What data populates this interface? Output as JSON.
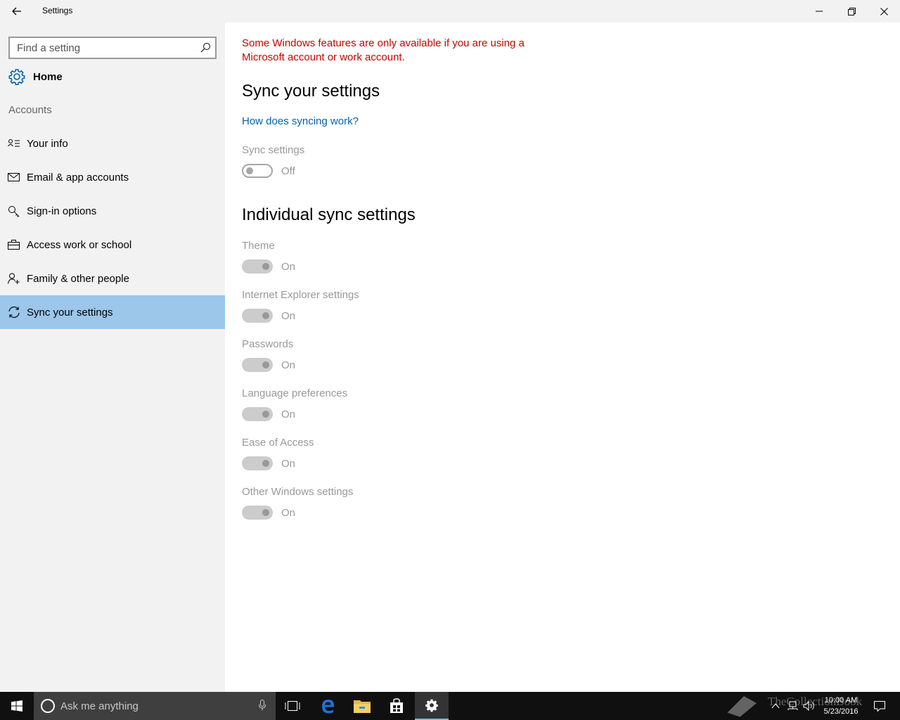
{
  "window": {
    "title": "Settings"
  },
  "sidebar": {
    "search_placeholder": "Find a setting",
    "home_label": "Home",
    "section_title": "Accounts",
    "items": [
      {
        "label": "Your info",
        "icon": "contact-info-icon"
      },
      {
        "label": "Email & app accounts",
        "icon": "mail-icon"
      },
      {
        "label": "Sign-in options",
        "icon": "key-icon"
      },
      {
        "label": "Access work or school",
        "icon": "briefcase-icon"
      },
      {
        "label": "Family & other people",
        "icon": "add-person-icon"
      },
      {
        "label": "Sync your settings",
        "icon": "sync-icon",
        "selected": true
      }
    ]
  },
  "main": {
    "warning": "Some Windows features are only available if you are using a Microsoft account or work account.",
    "heading": "Sync your settings",
    "help_link": "How does syncing work?",
    "sync_settings": {
      "label": "Sync settings",
      "state": "Off"
    },
    "individual_heading": "Individual sync settings",
    "individual": [
      {
        "label": "Theme",
        "state": "On"
      },
      {
        "label": "Internet Explorer settings",
        "state": "On"
      },
      {
        "label": "Passwords",
        "state": "On"
      },
      {
        "label": "Language preferences",
        "state": "On"
      },
      {
        "label": "Ease of Access",
        "state": "On"
      },
      {
        "label": "Other Windows settings",
        "state": "On"
      }
    ]
  },
  "taskbar": {
    "search_placeholder": "Ask me anything",
    "clock_time": "10:00 AM",
    "clock_date": "5/23/2016",
    "watermark": "TheCollectionBook"
  },
  "colors": {
    "accent": "#0063b1",
    "selected_nav": "#9cc6ea",
    "warning": "#c50500"
  }
}
